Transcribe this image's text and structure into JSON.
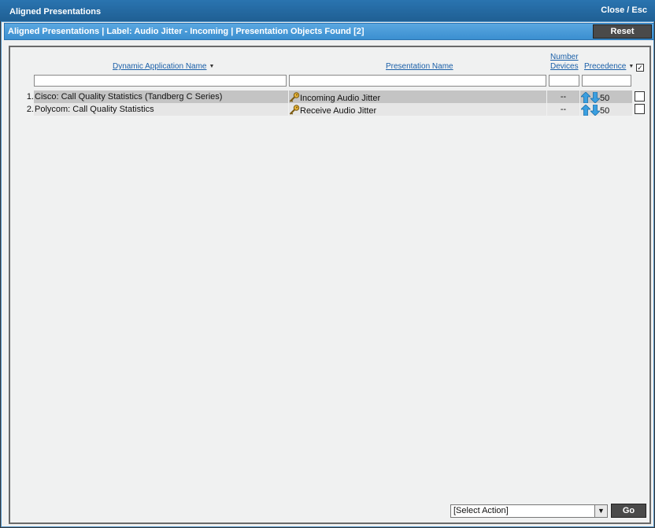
{
  "window": {
    "title": "Aligned Presentations",
    "close_label": "Close / Esc"
  },
  "subheader": {
    "title": "Aligned Presentations | Label: Audio Jitter - Incoming | Presentation Objects Found [2]",
    "reset_label": "Reset"
  },
  "table": {
    "columns": {
      "dynamic_app": "Dynamic Application Name",
      "presentation": "Presentation Name",
      "devices_line1": "Number",
      "devices_line2": "Devices",
      "precedence": "Precedence"
    },
    "rows": [
      {
        "index": "1.",
        "dynamic_app": "Cisco: Call Quality Statistics (Tandberg C Series)",
        "presentation": "Incoming Audio Jitter",
        "devices": "--",
        "precedence": "50"
      },
      {
        "index": "2.",
        "dynamic_app": "Polycom: Call Quality Statistics",
        "presentation": "Receive Audio Jitter",
        "devices": "--",
        "precedence": "50"
      }
    ]
  },
  "footer": {
    "action_select": "[Select Action]",
    "go_label": "Go"
  }
}
